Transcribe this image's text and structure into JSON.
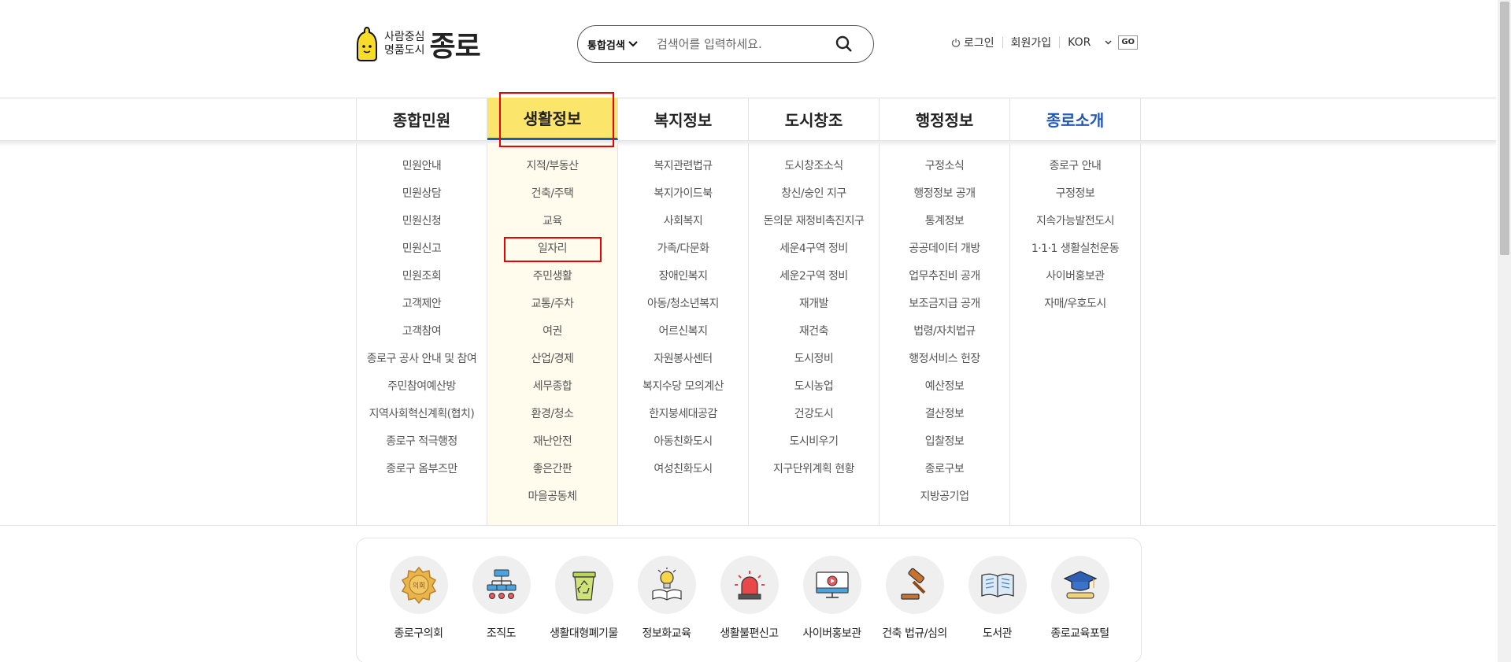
{
  "logo": {
    "slogan_line1": "사람중심",
    "slogan_line2": "명품도시",
    "name": "종로"
  },
  "search": {
    "scope_label": "통합검색",
    "placeholder": "검색어를 입력하세요."
  },
  "util": {
    "login": "로그인",
    "signup": "회원가입",
    "language": "KOR",
    "go": "GO"
  },
  "gnb": {
    "tabs": [
      {
        "label": "종합민원"
      },
      {
        "label": "생활정보"
      },
      {
        "label": "복지정보"
      },
      {
        "label": "도시창조"
      },
      {
        "label": "행정정보"
      },
      {
        "label": "종로소개"
      }
    ],
    "active_tab": "생활정보"
  },
  "menu": {
    "columns": [
      {
        "items": [
          "민원안내",
          "민원상담",
          "민원신청",
          "민원신고",
          "민원조회",
          "고객제안",
          "고객참여",
          "종로구 공사 안내 및 참여",
          "주민참여예산방",
          "지역사회혁신계획(협치)",
          "종로구 적극행정",
          "종로구 옴부즈만"
        ]
      },
      {
        "items": [
          "지적/부동산",
          "건축/주택",
          "교육",
          "일자리",
          "주민생활",
          "교통/주차",
          "여권",
          "산업/경제",
          "세무종합",
          "환경/청소",
          "재난안전",
          "좋은간판",
          "마을공동체"
        ]
      },
      {
        "items": [
          "복지관련법규",
          "복지가이드북",
          "사회복지",
          "가족/다문화",
          "장애인복지",
          "아동/청소년복지",
          "어르신복지",
          "자원봉사센터",
          "복지수당 모의계산",
          "한지붕세대공감",
          "아동친화도시",
          "여성친화도시"
        ]
      },
      {
        "items": [
          "도시창조소식",
          "창신/숭인 지구",
          "돈의문 재정비촉진지구",
          "세운4구역 정비",
          "세운2구역 정비",
          "재개발",
          "재건축",
          "도시정비",
          "도시농업",
          "건강도시",
          "도시비우기",
          "지구단위계획 현황"
        ]
      },
      {
        "items": [
          "구정소식",
          "행정정보 공개",
          "통계정보",
          "공공데이터 개방",
          "업무추진비 공개",
          "보조금지급 공개",
          "법령/자치법규",
          "행정서비스 헌장",
          "예산정보",
          "결산정보",
          "입찰정보",
          "종로구보",
          "지방공기업"
        ]
      },
      {
        "items": [
          "종로구 안내",
          "구정정보",
          "지속가능발전도시",
          "1·1·1 생활실천운동",
          "사이버홍보관",
          "자매/우호도시"
        ]
      }
    ],
    "highlighted_item": "일자리"
  },
  "quick_links": [
    {
      "label": "종로구의회",
      "icon": "council-emblem-icon"
    },
    {
      "label": "조직도",
      "icon": "org-chart-icon"
    },
    {
      "label": "생활대형폐기물",
      "icon": "recycle-bin-icon"
    },
    {
      "label": "정보화교육",
      "icon": "lightbulb-book-icon"
    },
    {
      "label": "생활불편신고",
      "icon": "siren-icon"
    },
    {
      "label": "사이버홍보관",
      "icon": "video-monitor-icon"
    },
    {
      "label": "건축 법규/심의",
      "icon": "gavel-icon"
    },
    {
      "label": "도서관",
      "icon": "open-book-icon"
    },
    {
      "label": "종로교육포털",
      "icon": "graduation-cap-icon"
    }
  ],
  "colors": {
    "active_tab_bg": "#fbe56b",
    "active_tab_underline": "#1f5fa8",
    "intro_tab_text": "#2458b5",
    "highlight_border": "#ee0000"
  }
}
